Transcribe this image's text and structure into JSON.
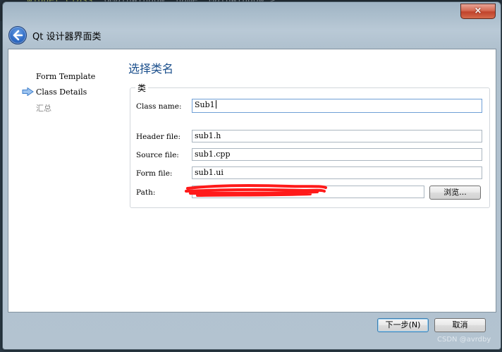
{
  "window": {
    "title": "Qt 设计器界面类",
    "close_label": "×"
  },
  "nav": {
    "items": [
      {
        "label": "Form Template",
        "current": false
      },
      {
        "label": "Class Details",
        "current": true
      },
      {
        "label": "汇总",
        "current": false
      }
    ]
  },
  "page": {
    "title": "选择类名",
    "group_label": "类"
  },
  "form": {
    "class_name_label": "Class name:",
    "class_name_value": "Sub1",
    "header_file_label": "Header file:",
    "header_file_value": "sub1.h",
    "source_file_label": "Source file:",
    "source_file_value": "sub1.cpp",
    "form_file_label": "Form file:",
    "form_file_value": "sub1.ui",
    "path_label": "Path:",
    "path_value": "",
    "browse_label": "浏览..."
  },
  "buttons": {
    "next_label": "下一步(N)",
    "cancel_label": "取消"
  },
  "watermark": "CSDN @avrdby",
  "colors": {
    "title_blue": "#1b4f8c",
    "nav_arrow": "#4a8ad6",
    "redaction": "#ff1a1a"
  }
}
